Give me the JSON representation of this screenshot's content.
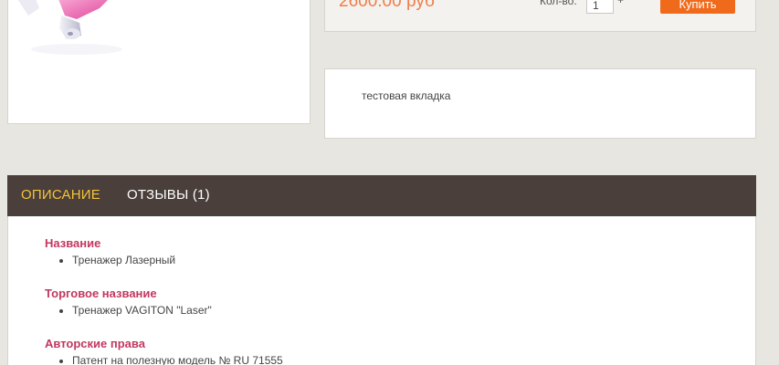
{
  "product": {
    "price": "2600.00 руб",
    "quantity_label": "Кол-во:",
    "quantity_value": "1",
    "quantity_stepper": "+",
    "buy_label": "Купить"
  },
  "custom_tab": {
    "text": "тестовая вкладка"
  },
  "tabs": [
    {
      "label": "ОПИСАНИЕ",
      "active": true
    },
    {
      "label": "ОТЗЫВЫ (1)",
      "active": false
    }
  ],
  "description": {
    "sections": [
      {
        "title": "Название",
        "items": [
          "Тренажер Лазерный"
        ]
      },
      {
        "title": "Торговое название",
        "items": [
          "Тренажер VAGITON \"Laser\""
        ]
      },
      {
        "title": "Авторские права",
        "items": [
          "Патент на полезную модель № RU 71555"
        ]
      }
    ]
  },
  "colors": {
    "page_background": "#e8e6e1",
    "accent_orange": "#f06a1c",
    "price_color": "#f07e4a",
    "tabs_bar": "#4a3f3a",
    "active_tab": "#f5c339",
    "section_title": "#c2385f"
  }
}
